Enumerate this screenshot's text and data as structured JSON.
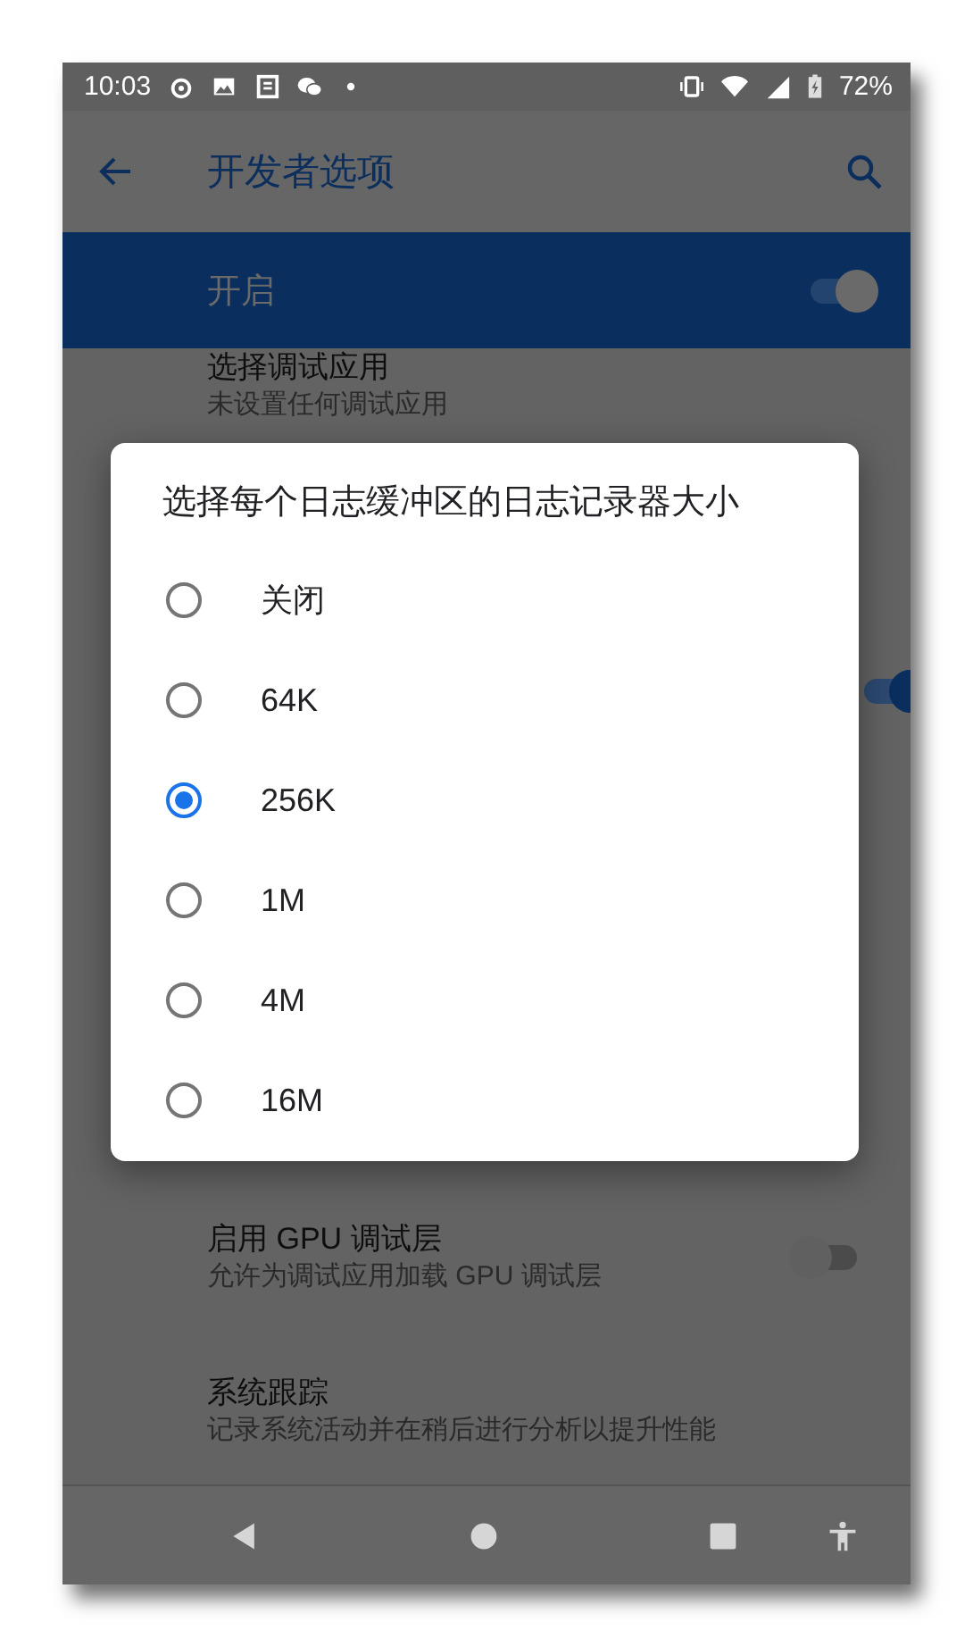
{
  "status_bar": {
    "time": "10:03",
    "battery": "72%"
  },
  "app_bar": {
    "title": "开发者选项"
  },
  "master_switch": {
    "label": "开启",
    "on": true
  },
  "settings": [
    {
      "kind": "text",
      "title": "选择调试应用",
      "subtitle": "未设置任何调试应用"
    },
    {
      "kind": "switch_only",
      "on": true
    },
    {
      "kind": "switch",
      "title": "启用 GPU 调试层",
      "subtitle": "允许为调试应用加载 GPU 调试层",
      "on": false
    },
    {
      "kind": "text",
      "title": "系统跟踪",
      "subtitle": "记录系统活动并在稍后进行分析以提升性能"
    }
  ],
  "dialog": {
    "title": "选择每个日志缓冲区的日志记录器大小",
    "options": [
      {
        "label": "关闭",
        "selected": false
      },
      {
        "label": "64K",
        "selected": false
      },
      {
        "label": "256K",
        "selected": true
      },
      {
        "label": "1M",
        "selected": false
      },
      {
        "label": "4M",
        "selected": false
      },
      {
        "label": "16M",
        "selected": false
      }
    ]
  }
}
